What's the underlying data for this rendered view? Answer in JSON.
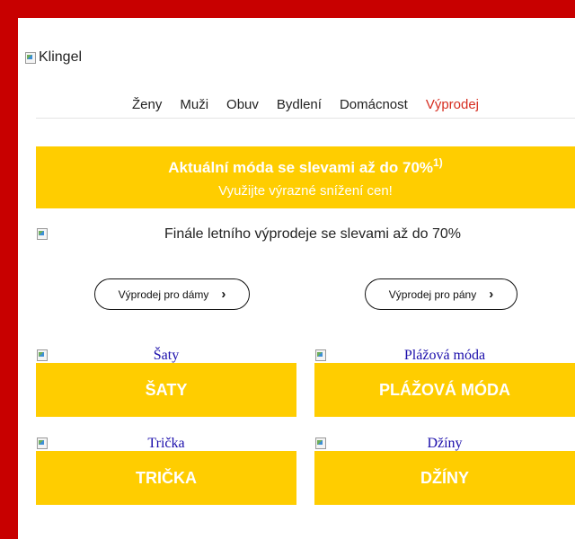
{
  "logo": {
    "alt": "Klingel"
  },
  "nav": {
    "items": [
      "Ženy",
      "Muži",
      "Obuv",
      "Bydlení",
      "Domácnost"
    ],
    "sale": "Výprodej"
  },
  "banner": {
    "title": "Aktuální móda se slevami až do 70%",
    "footnote": "1)",
    "subtitle": "Využijte výrazné snížení cen!"
  },
  "finale": {
    "text": "Finále letního výprodeje se slevami až do 70%"
  },
  "buttons": {
    "women": "Výprodej pro dámy",
    "men": "Výprodej pro pány",
    "chevron": "›"
  },
  "tiles": [
    {
      "alt": "Šaty",
      "label": "ŠATY"
    },
    {
      "alt": "Plážová móda",
      "label": "PLÁŽOVÁ MÓDA"
    },
    {
      "alt": "Trička",
      "label": "TRIČKA"
    },
    {
      "alt": "Džíny",
      "label": "DŽÍNY"
    }
  ],
  "colors": {
    "frame": "#c80000",
    "accent": "#ffcd00",
    "sale": "#d62d20",
    "link": "#1a0dab"
  }
}
